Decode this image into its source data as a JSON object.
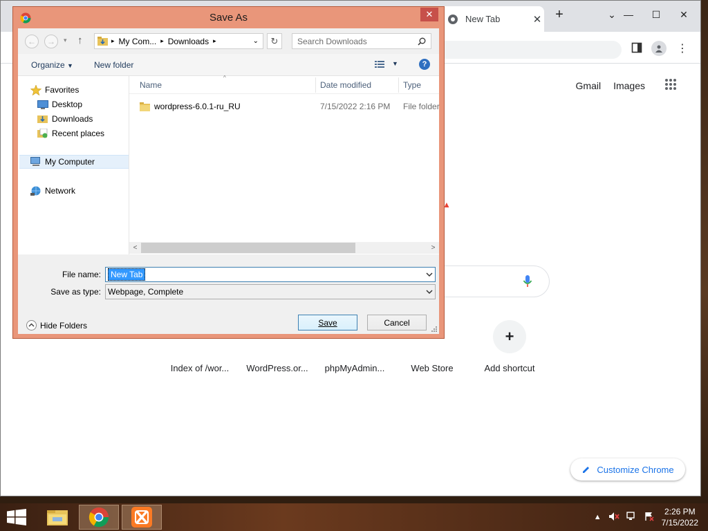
{
  "chrome": {
    "tab_title": "New Tab",
    "header_links": [
      "Gmail",
      "Images"
    ],
    "shortcuts": [
      {
        "label": "Index of /wor...",
        "icon": "xampp-icon"
      },
      {
        "label": "WordPress.or...",
        "icon": "wordpress-icon"
      },
      {
        "label": "phpMyAdmin...",
        "icon": "pma-icon"
      },
      {
        "label": "Web Store",
        "icon": "webstore-icon"
      },
      {
        "label": "Add shortcut",
        "icon": "plus-icon"
      }
    ],
    "customize_label": "Customize Chrome"
  },
  "dialog": {
    "title": "Save As",
    "breadcrumb": [
      "My Com...",
      "Downloads"
    ],
    "search_placeholder": "Search Downloads",
    "organize_label": "Organize",
    "new_folder_label": "New folder",
    "nav": {
      "favorites": "Favorites",
      "desktop": "Desktop",
      "downloads": "Downloads",
      "recent": "Recent places",
      "computer": "My Computer",
      "network": "Network"
    },
    "columns": {
      "name": "Name",
      "date": "Date modified",
      "type": "Type"
    },
    "files": [
      {
        "name": "wordpress-6.0.1-ru_RU",
        "date": "7/15/2022 2:16 PM",
        "type": "File folder"
      }
    ],
    "file_name_label": "File name:",
    "file_name_value": "New Tab",
    "save_type_label": "Save as type:",
    "save_type_value": "Webpage, Complete",
    "hide_folders_label": "Hide Folders",
    "save_button": "Save",
    "cancel_button": "Cancel"
  },
  "taskbar": {
    "time": "2:26 PM",
    "date": "7/15/2022"
  },
  "colors": {
    "dialog_frame": "#e9967a",
    "close_red": "#c7504a",
    "chrome_blue": "#1a73e8",
    "selection_blue": "#3399ff"
  }
}
